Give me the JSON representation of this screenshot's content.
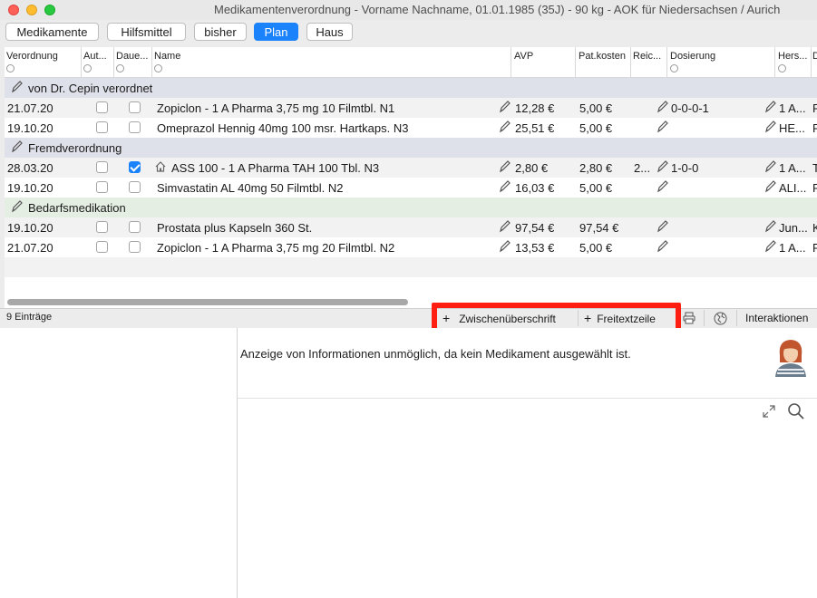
{
  "window": {
    "title": "Medikamentenverordnung - Vorname Nachname, 01.01.1985 (35J) - 90 kg - AOK für Niedersachsen / Aurich"
  },
  "tabs": [
    {
      "label": "Medikamente",
      "active": false
    },
    {
      "label": "Hilfsmittel",
      "active": false
    },
    {
      "label": "bisher",
      "active": false
    },
    {
      "label": "Plan",
      "active": true
    },
    {
      "label": "Haus",
      "active": false
    }
  ],
  "table": {
    "columns": [
      "Verordnung",
      "Aut...",
      "Daue...",
      "Name",
      "AVP",
      "Pat.kosten",
      "Reic...",
      "Dosierung",
      "Hers...",
      "D"
    ],
    "groups": [
      {
        "title": "von Dr. Cepin verordnet",
        "rows": [
          {
            "date": "21.07.20",
            "aut": false,
            "dauer": false,
            "home": false,
            "name": "Zopiclon - 1 A Pharma 3,75 mg 10 Filmtbl. N1",
            "avp": "12,28 €",
            "patkosten": "5,00 €",
            "reich": "",
            "dosierung": "0-0-0-1",
            "hersteller": "1 A...",
            "d": "F"
          },
          {
            "date": "19.10.20",
            "aut": false,
            "dauer": false,
            "home": false,
            "name": "Omeprazol Hennig 40mg 100 msr. Hartkaps. N3",
            "avp": "25,51 €",
            "patkosten": "5,00 €",
            "reich": "",
            "dosierung": "",
            "hersteller": "HE...",
            "d": "F"
          }
        ]
      },
      {
        "title": "Fremdverordnung",
        "rows": [
          {
            "date": "28.03.20",
            "aut": false,
            "dauer": true,
            "home": true,
            "name": "ASS 100 - 1 A Pharma TAH 100 Tbl. N3",
            "avp": "2,80 €",
            "patkosten": "2,80 €",
            "reich": "2...",
            "dosierung": "1-0-0",
            "hersteller": "1 A...",
            "d": "T"
          },
          {
            "date": "19.10.20",
            "aut": false,
            "dauer": false,
            "home": false,
            "name": "Simvastatin AL 40mg 50 Filmtbl. N2",
            "avp": "16,03 €",
            "patkosten": "5,00 €",
            "reich": "",
            "dosierung": "",
            "hersteller": "ALI...",
            "d": "F"
          }
        ]
      },
      {
        "title": "Bedarfsmedikation",
        "rows": [
          {
            "date": "19.10.20",
            "aut": false,
            "dauer": false,
            "home": false,
            "name": "Prostata plus Kapseln 360 St.",
            "avp": "97,54 €",
            "patkosten": "97,54 €",
            "reich": "",
            "dosierung": "",
            "hersteller": "Jun...",
            "d": "K"
          },
          {
            "date": "21.07.20",
            "aut": false,
            "dauer": false,
            "home": false,
            "name": "Zopiclon - 1 A Pharma 3,75 mg 20 Filmtbl. N2",
            "avp": "13,53 €",
            "patkosten": "5,00 €",
            "reich": "",
            "dosierung": "",
            "hersteller": "1 A...",
            "d": "F"
          }
        ]
      }
    ]
  },
  "status": {
    "count": "9 Einträge",
    "add_heading": "Zwischenüberschrift",
    "add_freetext": "Freitextzeile",
    "interactions": "Interaktionen"
  },
  "info": {
    "message": "Anzeige von Informationen unmöglich, da kein Medikament ausgewählt ist."
  },
  "colors": {
    "accent": "#1a82fb",
    "highlight": "#ff1e12",
    "group_row": "#dfe1ea",
    "group_row_green": "#e4eee3"
  }
}
